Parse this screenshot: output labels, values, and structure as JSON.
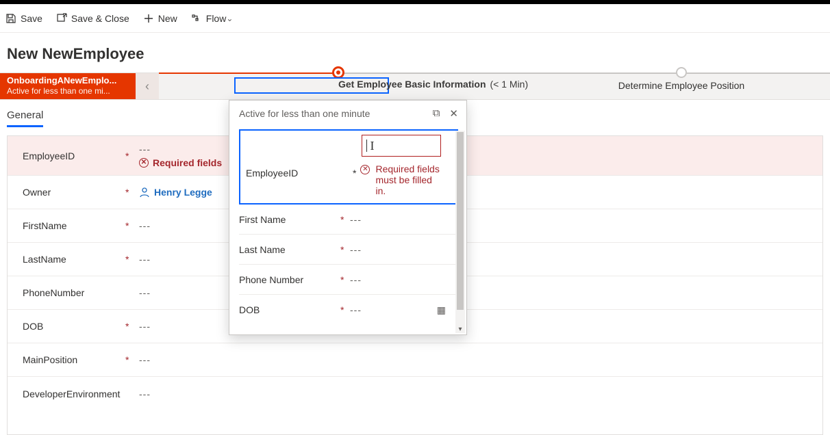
{
  "cmdbar": {
    "save": "Save",
    "save_close": "Save & Close",
    "new": "New",
    "flow": "Flow"
  },
  "page_title": "New NewEmployee",
  "bpf": {
    "process_name": "OnboardingANewEmplo...",
    "process_sub": "Active for less than one mi...",
    "stage_active_name": "Get Employee Basic Information",
    "stage_active_dur": "(< 1 Min)",
    "stage_future": "Determine Employee Position"
  },
  "tabs": {
    "general": "General"
  },
  "form": {
    "employee_id_label": "EmployeeID",
    "employee_id_value": "---",
    "employee_id_error": "Required fields",
    "owner_label": "Owner",
    "owner_value": "Henry Legge",
    "firstname_label": "FirstName",
    "firstname_value": "---",
    "lastname_label": "LastName",
    "lastname_value": "---",
    "phone_label": "PhoneNumber",
    "phone_value": "---",
    "dob_label": "DOB",
    "dob_value": "---",
    "mainposition_label": "MainPosition",
    "mainposition_value": "---",
    "devenv_label": "DeveloperEnvironment",
    "devenv_value": "---"
  },
  "flyout": {
    "status": "Active for less than one minute",
    "employee_id_label": "EmployeeID",
    "employee_id_error": "Required fields must be filled in.",
    "firstname_label": "First Name",
    "firstname_value": "---",
    "lastname_label": "Last Name",
    "lastname_value": "---",
    "phone_label": "Phone Number",
    "phone_value": "---",
    "dob_label": "DOB",
    "dob_value": "---"
  },
  "req_mark": "*"
}
